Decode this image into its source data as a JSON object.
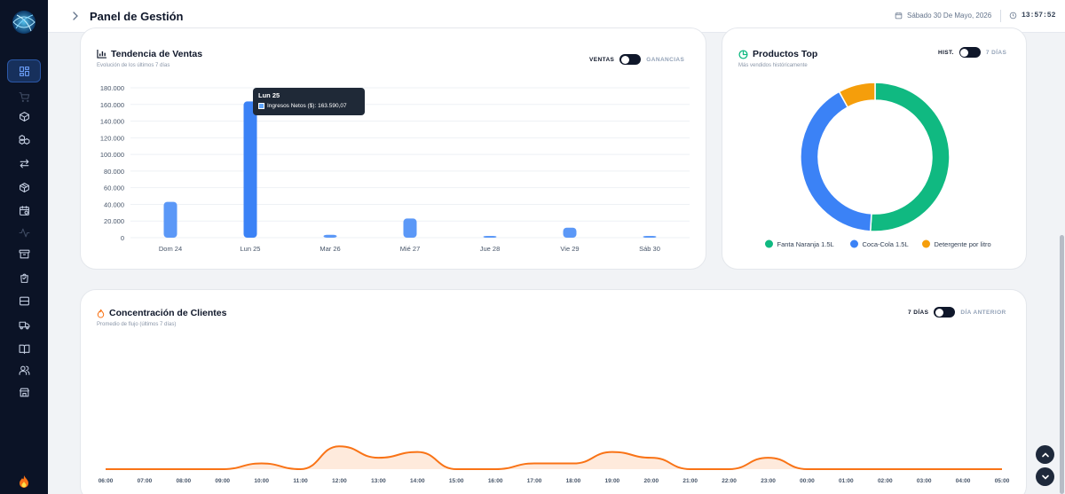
{
  "header": {
    "title": "Panel de Gestión",
    "date": "Sábado 30 De Mayo, 2026",
    "time": "13:57:52"
  },
  "sidebar": {
    "items": [
      "dashboard-icon",
      "cart-icon",
      "box-icon",
      "boxes-icon",
      "transfer-icon",
      "package-icon",
      "calendar-icon",
      "activity-icon",
      "archive-icon",
      "bag-icon",
      "wallet-icon",
      "truck-icon",
      "book-icon",
      "users-icon",
      "store-icon"
    ]
  },
  "sales": {
    "title": "Tendencia de Ventas",
    "subtitle": "Evolución de los últimos 7 días",
    "toggle_on": "VENTAS",
    "toggle_off": "GANANCIAS",
    "tooltip": {
      "title": "Lun 25",
      "label": "Ingresos Netos ($): 163.590,07"
    }
  },
  "products": {
    "title": "Productos Top",
    "subtitle": "Más vendidos históricamente",
    "toggle_on": "HIST.",
    "toggle_off": "7 DÍAS"
  },
  "clients": {
    "title": "Concentración de Clientes",
    "subtitle": "Promedio de flujo (últimos 7 días)",
    "toggle_on": "7 DÍAS",
    "toggle_off": "DÍA ANTERIOR"
  },
  "chart_data": [
    {
      "type": "bar",
      "title": "Tendencia de Ventas",
      "categories": [
        "Dom 24",
        "Lun 25",
        "Mar 26",
        "Mié 27",
        "Jue 28",
        "Vie 29",
        "Sáb 30"
      ],
      "series": [
        {
          "name": "Ingresos Netos ($)",
          "values": [
            43000,
            163590.07,
            3500,
            23000,
            500,
            12000,
            300
          ]
        }
      ],
      "ylim": [
        0,
        180000
      ],
      "yticks": [
        "180.000",
        "160.000",
        "140.000",
        "120.000",
        "100.000",
        "80.000",
        "60.000",
        "40.000",
        "20.000",
        "0"
      ],
      "grid": true,
      "color": "#3b82f6"
    },
    {
      "type": "pie",
      "title": "Productos Top",
      "labels": [
        "Fanta Naranja 1.5L",
        "Coca-Cola 1.5L",
        "Detergente por litro"
      ],
      "values": [
        51,
        41,
        8
      ],
      "colors": [
        "#10b981",
        "#3b82f6",
        "#f59e0b"
      ],
      "legend": "bottom"
    },
    {
      "type": "area",
      "title": "Concentración de Clientes",
      "x": [
        "06:00",
        "07:00",
        "08:00",
        "09:00",
        "10:00",
        "11:00",
        "12:00",
        "13:00",
        "14:00",
        "15:00",
        "16:00",
        "17:00",
        "18:00",
        "19:00",
        "20:00",
        "21:00",
        "22:00",
        "23:00",
        "00:00",
        "01:00",
        "02:00",
        "03:00",
        "04:00",
        "05:00"
      ],
      "values": [
        0,
        0,
        0,
        0,
        1.5,
        0,
        6,
        3,
        4.5,
        0,
        0,
        1.5,
        1.5,
        4.5,
        3,
        0,
        0,
        3,
        0,
        0,
        0,
        0,
        0,
        0
      ],
      "color": "#f97316"
    }
  ]
}
